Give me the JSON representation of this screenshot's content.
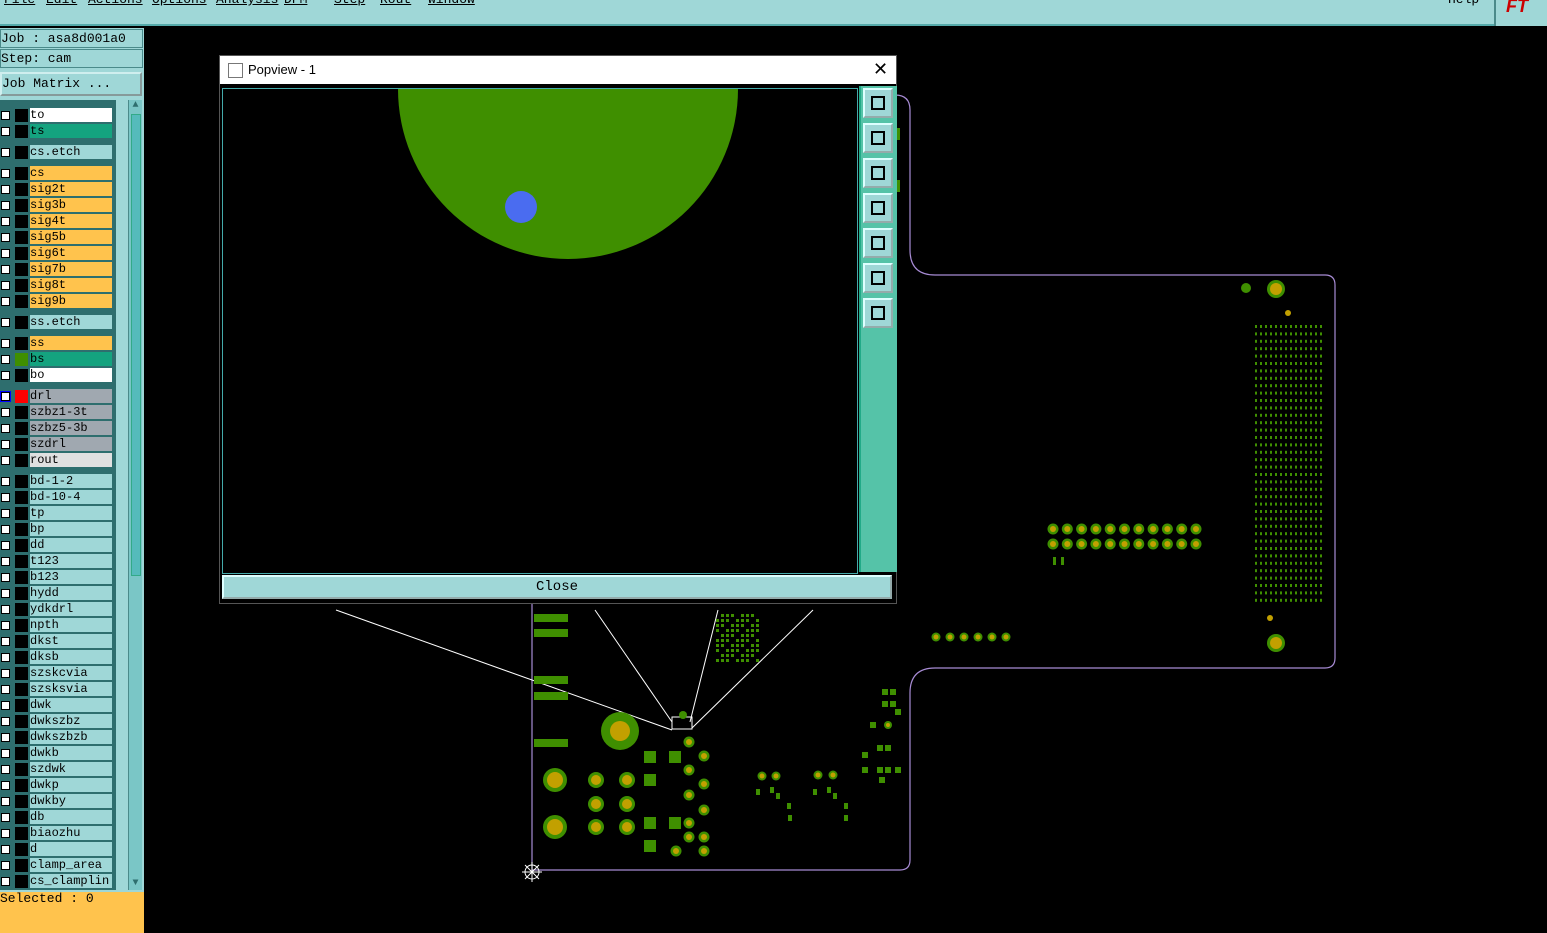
{
  "menubar": {
    "items": [
      "File",
      "Edit",
      "Actions",
      "Options",
      "Analysis",
      "DFM",
      "Step",
      "Rout",
      "Window"
    ],
    "help": "Help"
  },
  "corner": {
    "logo": "FT"
  },
  "job": {
    "job_line": "Job : asa8d001a0",
    "step_line": "Step: cam",
    "matrix_label": "Job Matrix ..."
  },
  "status": {
    "selected": "Selected : 0"
  },
  "popup": {
    "title": "Popview - 1",
    "close_label": "Close"
  },
  "colors": {
    "panel": "#9fd7d7",
    "signal": "#ffc34d",
    "mask": "#14a37f",
    "copper": "#3f8f00",
    "pad": "#c2a000",
    "drill": "#a0a8b0",
    "outline": "#a78bd4"
  },
  "layers": [
    {
      "name": "to",
      "color": "#ffffff",
      "edit": true
    },
    {
      "name": "ts",
      "color": "#14a37f"
    },
    {
      "name": "cs.etch",
      "color": "#9fd7d7",
      "gap": true
    },
    {
      "name": "cs",
      "color": "#ffc34d",
      "gap": true
    },
    {
      "name": "sig2t",
      "color": "#ffc34d"
    },
    {
      "name": "sig3b",
      "color": "#ffc34d"
    },
    {
      "name": "sig4t",
      "color": "#ffc34d"
    },
    {
      "name": "sig5b",
      "color": "#ffc34d"
    },
    {
      "name": "sig6t",
      "color": "#ffc34d"
    },
    {
      "name": "sig7b",
      "color": "#ffc34d"
    },
    {
      "name": "sig8t",
      "color": "#ffc34d"
    },
    {
      "name": "sig9b",
      "color": "#ffc34d"
    },
    {
      "name": "ss.etch",
      "color": "#9fd7d7",
      "gap": true
    },
    {
      "name": "ss",
      "color": "#ffc34d",
      "gap": true
    },
    {
      "name": "bs",
      "color": "#14a37f",
      "swatch": "#3f8f00"
    },
    {
      "name": "bo",
      "color": "#ffffff",
      "edit": true
    },
    {
      "name": "drl",
      "color": "#a0a8b0",
      "swatch": "#ff0000",
      "selected": true,
      "gap": true
    },
    {
      "name": "szbz1-3t",
      "color": "#a0a8b0"
    },
    {
      "name": "szbz5-3b",
      "color": "#a0a8b0"
    },
    {
      "name": "szdrl",
      "color": "#a0a8b0"
    },
    {
      "name": "rout",
      "color": "#e0e0e0"
    },
    {
      "name": "bd-1-2",
      "color": "#9fd7d7",
      "gap": true
    },
    {
      "name": "bd-10-4",
      "color": "#9fd7d7"
    },
    {
      "name": "tp",
      "color": "#9fd7d7"
    },
    {
      "name": "bp",
      "color": "#9fd7d7"
    },
    {
      "name": "dd",
      "color": "#9fd7d7"
    },
    {
      "name": "t123",
      "color": "#9fd7d7"
    },
    {
      "name": "b123",
      "color": "#9fd7d7"
    },
    {
      "name": "hydd",
      "color": "#9fd7d7"
    },
    {
      "name": "ydkdrl",
      "color": "#9fd7d7"
    },
    {
      "name": "npth",
      "color": "#9fd7d7"
    },
    {
      "name": "dkst",
      "color": "#9fd7d7"
    },
    {
      "name": "dksb",
      "color": "#9fd7d7"
    },
    {
      "name": "szskcvia",
      "color": "#9fd7d7"
    },
    {
      "name": "szsksvia",
      "color": "#9fd7d7"
    },
    {
      "name": "dwk",
      "color": "#9fd7d7"
    },
    {
      "name": "dwkszbz",
      "color": "#9fd7d7"
    },
    {
      "name": "dwkszbzb",
      "color": "#9fd7d7"
    },
    {
      "name": "dwkb",
      "color": "#9fd7d7"
    },
    {
      "name": "szdwk",
      "color": "#9fd7d7"
    },
    {
      "name": "dwkp",
      "color": "#9fd7d7"
    },
    {
      "name": "dwkby",
      "color": "#9fd7d7"
    },
    {
      "name": "db",
      "color": "#9fd7d7"
    },
    {
      "name": "biaozhu",
      "color": "#9fd7d7"
    },
    {
      "name": "d",
      "color": "#9fd7d7"
    },
    {
      "name": "clamp_area",
      "color": "#9fd7d7"
    },
    {
      "name": "cs_clamplin",
      "color": "#9fd7d7"
    }
  ],
  "toolbar_icons": [
    "fit-view-icon",
    "zoom-up-icon",
    "zoom-down-icon",
    "pan-left-icon",
    "pan-right-icon",
    "zoom-out-icon",
    "zoom-in-icon"
  ]
}
